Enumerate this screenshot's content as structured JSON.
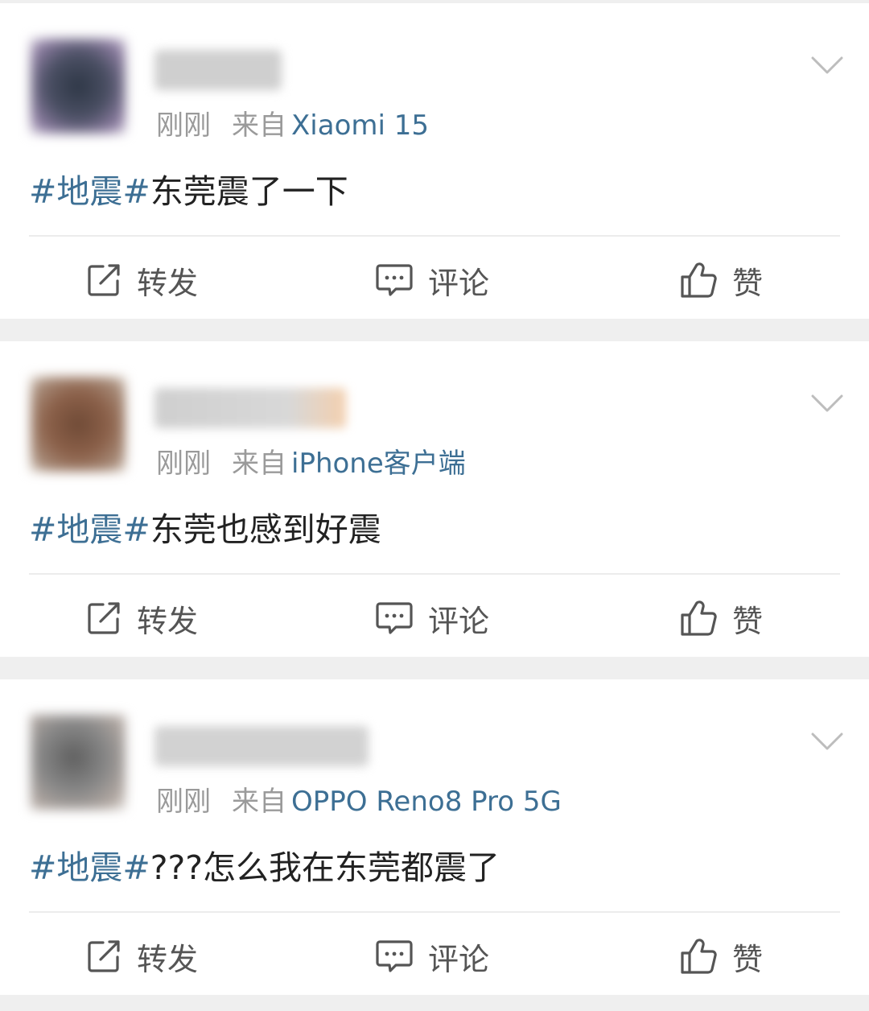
{
  "posts": [
    {
      "time": "刚刚",
      "from_label": "来自",
      "device": "Xiaomi 15",
      "topic": "#地震#",
      "text": "东莞震了一下",
      "actions": {
        "repost": "转发",
        "comment": "评论",
        "like": "赞"
      }
    },
    {
      "time": "刚刚",
      "from_label": "来自",
      "device": "iPhone客户端",
      "topic": "#地震#",
      "text": "东莞也感到好震",
      "actions": {
        "repost": "转发",
        "comment": "评论",
        "like": "赞"
      }
    },
    {
      "time": "刚刚",
      "from_label": "来自",
      "device": "OPPO Reno8 Pro 5G",
      "topic": "#地震#",
      "text": "???怎么我在东莞都震了",
      "actions": {
        "repost": "转发",
        "comment": "评论",
        "like": "赞"
      }
    }
  ],
  "colors": {
    "link": "#3d6f94",
    "meta_gray": "#9a9a9a",
    "text": "#222222",
    "separator": "#efefef"
  },
  "icons": {
    "repost": "share-square-arrow-icon",
    "comment": "speech-bubble-icon",
    "like": "thumbs-up-icon",
    "more": "chevron-down-icon"
  }
}
